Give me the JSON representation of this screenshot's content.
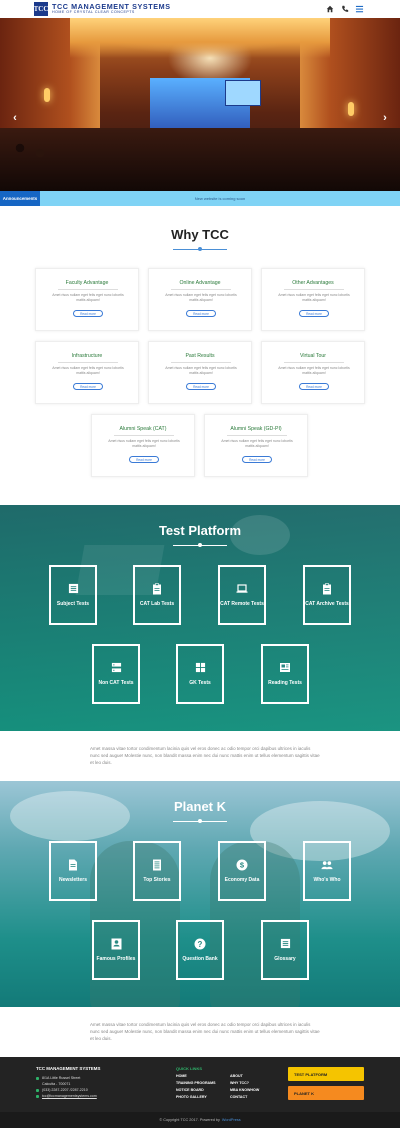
{
  "header": {
    "logo_text": "TCC",
    "brand_title": "TCC MANAGEMENT SYSTEMS",
    "brand_subtitle": "HOME OF CRYSTAL CLEAR CONCEPTS",
    "icons": [
      "home-icon",
      "phone-icon",
      "menu-icon"
    ]
  },
  "hero": {
    "prev": "‹",
    "next": "›"
  },
  "announcement": {
    "label": "Announcements",
    "text": "New website is coming soon"
  },
  "why": {
    "title": "Why TCC",
    "cards": [
      {
        "title": "Faculty Advantage",
        "text": "Amet risus nullam eget felis eget nunc lobortis mattis aliquam!",
        "button": "Read more"
      },
      {
        "title": "Online Advantage",
        "text": "Amet risus nullam eget felis eget nunc lobortis mattis aliquam!",
        "button": "Read more"
      },
      {
        "title": "Other Advantages",
        "text": "Amet risus nullam eget felis eget nunc lobortis mattis aliquam!",
        "button": "Read more"
      },
      {
        "title": "Infrastructure",
        "text": "Amet risus nullam eget felis eget nunc lobortis mattis aliquam!",
        "button": "Read more"
      },
      {
        "title": "Past Results",
        "text": "Amet risus nullam eget felis eget nunc lobortis mattis aliquam!",
        "button": "Read more"
      },
      {
        "title": "Virtual Tour",
        "text": "Amet risus nullam eget felis eget nunc lobortis mattis aliquam!",
        "button": "Read more"
      },
      {
        "title": "Alumni Speak (CAT)",
        "text": "Amet risus nullam eget felis eget nunc lobortis mattis aliquam!",
        "button": "Read more"
      },
      {
        "title": "Alumni Speak (GD-PI)",
        "text": "Amet risus nullam eget felis eget nunc lobortis mattis aliquam!",
        "button": "Read more"
      }
    ]
  },
  "test_platform": {
    "title": "Test Platform",
    "tiles": [
      {
        "label": "Subject Tests",
        "icon": "list-icon"
      },
      {
        "label": "CAT Lab Tests",
        "icon": "clipboard-icon"
      },
      {
        "label": "CAT Remote Tests",
        "icon": "laptop-icon"
      },
      {
        "label": "CAT Archive Tests",
        "icon": "clipboard-icon"
      },
      {
        "label": "Non CAT Tests",
        "icon": "server-icon"
      },
      {
        "label": "GK Tests",
        "icon": "grid-icon"
      },
      {
        "label": "Reading Tests",
        "icon": "newspaper-icon"
      }
    ]
  },
  "para1": "Amet massa vitae tortor condimentum lacinia quis vel eros donec ac odio tempor orci dapibus ultrices in iaculis nunc sed augue! Molestie nunc, non blandit massa enim nec dui nunc mattis enim ut tellus elementum sagittis vitae et leo duis.",
  "planet_k": {
    "title": "Planet K",
    "tiles": [
      {
        "label": "Newsletters",
        "icon": "document-icon"
      },
      {
        "label": "Top Stories",
        "icon": "document-lines-icon"
      },
      {
        "label": "Economy Data",
        "icon": "dollar-icon"
      },
      {
        "label": "Who's Who",
        "icon": "people-icon"
      },
      {
        "label": "Famous Profiles",
        "icon": "profile-card-icon"
      },
      {
        "label": "Question Bank",
        "icon": "question-icon"
      },
      {
        "label": "Glossary",
        "icon": "list-icon"
      }
    ]
  },
  "para2": "Amet massa vitae tortor condimentum lacinia quis vel eros donec ac odio tempor orci dapibus ultrices in iaculis nunc sed augue! Molestie nunc, non blandit massa enim nec dui nunc mattis enim ut tellus elementum sagittis vitae et leo duis.",
  "footer": {
    "title": "TCC MANAGEMENT SYSTEMS",
    "address1": "8/1A Little Russel Street",
    "address2": "Calcutta - 700071",
    "phone": "(033) 2287-2207 /2287-2210",
    "email": "tcc@tccmanagementsystems.com",
    "quick_links_title": "QUICK LINKS",
    "links_left": [
      "HOME",
      "TRAINING PROGRAMS",
      "NOTICE BOARD",
      "PHOTO GALLERY"
    ],
    "links_right": [
      "ABOUT",
      "WHY TCC?",
      "MBA KNOWHOW",
      "CONTACT"
    ],
    "btn_test": "TEST PLATFORM",
    "btn_planet": "PLANET K"
  },
  "copyright": {
    "text": "© Copyright TCC 2017. Powered by",
    "link": "WordPress"
  },
  "colors": {
    "brand": "#1b3a8c",
    "accent": "#1666c4",
    "teal": "#1e8f8a",
    "green": "#2a7a3a",
    "yellow": "#f5c400",
    "orange": "#f58a1f"
  }
}
